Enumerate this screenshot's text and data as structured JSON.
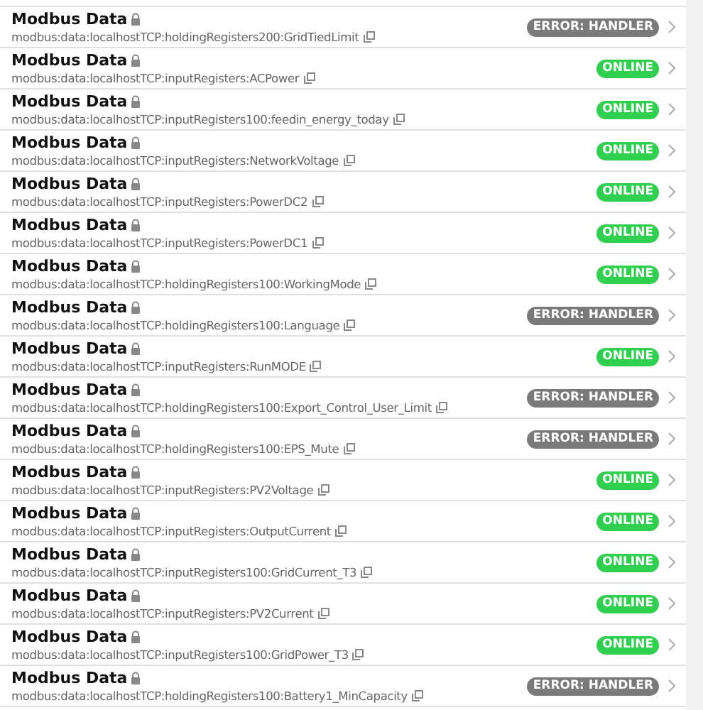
{
  "things": [
    {
      "title": "Modbus Data",
      "uid": "modbus:data:localhostTCP:holdingRegisters200:GridTiedLimit",
      "status": {
        "kind": "error",
        "label": "ERROR: HANDLER"
      }
    },
    {
      "title": "Modbus Data",
      "uid": "modbus:data:localhostTCP:inputRegisters:ACPower",
      "status": {
        "kind": "online",
        "label": "ONLINE"
      }
    },
    {
      "title": "Modbus Data",
      "uid": "modbus:data:localhostTCP:inputRegisters100:feedin_energy_today",
      "status": {
        "kind": "online",
        "label": "ONLINE"
      }
    },
    {
      "title": "Modbus Data",
      "uid": "modbus:data:localhostTCP:inputRegisters:NetworkVoltage",
      "status": {
        "kind": "online",
        "label": "ONLINE"
      }
    },
    {
      "title": "Modbus Data",
      "uid": "modbus:data:localhostTCP:inputRegisters:PowerDC2",
      "status": {
        "kind": "online",
        "label": "ONLINE"
      }
    },
    {
      "title": "Modbus Data",
      "uid": "modbus:data:localhostTCP:inputRegisters:PowerDC1",
      "status": {
        "kind": "online",
        "label": "ONLINE"
      }
    },
    {
      "title": "Modbus Data",
      "uid": "modbus:data:localhostTCP:holdingRegisters100:WorkingMode",
      "status": {
        "kind": "online",
        "label": "ONLINE"
      }
    },
    {
      "title": "Modbus Data",
      "uid": "modbus:data:localhostTCP:holdingRegisters100:Language",
      "status": {
        "kind": "error",
        "label": "ERROR: HANDLER"
      }
    },
    {
      "title": "Modbus Data",
      "uid": "modbus:data:localhostTCP:inputRegisters:RunMODE",
      "status": {
        "kind": "online",
        "label": "ONLINE"
      }
    },
    {
      "title": "Modbus Data",
      "uid": "modbus:data:localhostTCP:holdingRegisters100:Export_Control_User_Limit",
      "status": {
        "kind": "error",
        "label": "ERROR: HANDLER"
      }
    },
    {
      "title": "Modbus Data",
      "uid": "modbus:data:localhostTCP:holdingRegisters100:EPS_Mute",
      "status": {
        "kind": "error",
        "label": "ERROR: HANDLER"
      }
    },
    {
      "title": "Modbus Data",
      "uid": "modbus:data:localhostTCP:inputRegisters:PV2Voltage",
      "status": {
        "kind": "online",
        "label": "ONLINE"
      }
    },
    {
      "title": "Modbus Data",
      "uid": "modbus:data:localhostTCP:inputRegisters:OutputCurrent",
      "status": {
        "kind": "online",
        "label": "ONLINE"
      }
    },
    {
      "title": "Modbus Data",
      "uid": "modbus:data:localhostTCP:inputRegisters100:GridCurrent_T3",
      "status": {
        "kind": "online",
        "label": "ONLINE"
      }
    },
    {
      "title": "Modbus Data",
      "uid": "modbus:data:localhostTCP:inputRegisters:PV2Current",
      "status": {
        "kind": "online",
        "label": "ONLINE"
      }
    },
    {
      "title": "Modbus Data",
      "uid": "modbus:data:localhostTCP:inputRegisters100:GridPower_T3",
      "status": {
        "kind": "online",
        "label": "ONLINE"
      }
    },
    {
      "title": "Modbus Data",
      "uid": "modbus:data:localhostTCP:holdingRegisters100:Battery1_MinCapacity",
      "status": {
        "kind": "error",
        "label": "ERROR: HANDLER"
      }
    }
  ]
}
